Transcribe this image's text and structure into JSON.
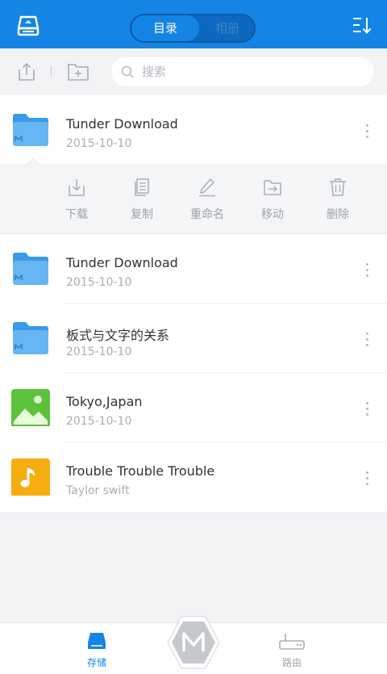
{
  "header": {
    "tabs": [
      {
        "label": "目录",
        "active": true
      },
      {
        "label": "相册",
        "active": false
      }
    ],
    "accent_color": "#1485e4"
  },
  "toolbar": {
    "search_placeholder": "搜索"
  },
  "files": [
    {
      "title": "Tunder Download",
      "subtitle": "2015-10-10",
      "icon": "folder-icon"
    },
    {
      "title": "Tunder Download",
      "subtitle": "2015-10-10",
      "icon": "folder-icon"
    },
    {
      "title": "板式与文字的关系",
      "subtitle": "2015-10-10",
      "icon": "folder-icon"
    },
    {
      "title": "Tokyo,Japan",
      "subtitle": "2015-10-10",
      "icon": "image-icon"
    },
    {
      "title": "Trouble Trouble Trouble",
      "subtitle": "Taylor swift",
      "icon": "music-icon"
    }
  ],
  "actions": [
    {
      "label": "下载",
      "icon": "download-icon"
    },
    {
      "label": "复制",
      "icon": "copy-icon"
    },
    {
      "label": "重命名",
      "icon": "pencil-icon"
    },
    {
      "label": "移动",
      "icon": "move-icon"
    },
    {
      "label": "删除",
      "icon": "trash-icon"
    }
  ],
  "bottom_nav": {
    "left": {
      "label": "存储",
      "icon": "storage-icon",
      "active": true
    },
    "center": {
      "icon": "m-logo-icon"
    },
    "right": {
      "label": "路由",
      "icon": "router-icon",
      "active": false
    }
  }
}
